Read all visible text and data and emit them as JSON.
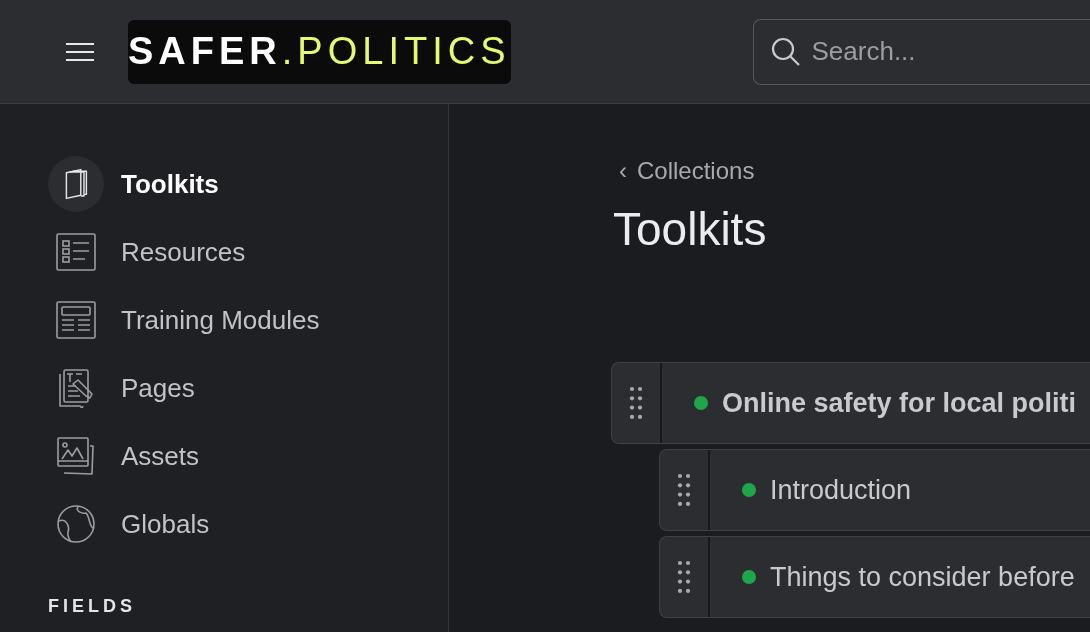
{
  "header": {
    "logo": "**SAFER**.POLITICS",
    "search": {
      "placeholder": "Search..."
    }
  },
  "sidebar": {
    "items": [
      {
        "label": "Toolkits",
        "selected": true
      },
      {
        "label": "Resources",
        "selected": false
      },
      {
        "label": "Training Modules",
        "selected": false
      },
      {
        "label": "Pages",
        "selected": false
      },
      {
        "label": "Assets",
        "selected": false
      },
      {
        "label": "Globals",
        "selected": false
      }
    ],
    "section_heading": "FIELDS"
  },
  "main": {
    "breadcrumb": {
      "caret": "‹",
      "label": "Collections"
    },
    "title": "Toolkits",
    "tree": [
      {
        "title": "Online safety for local politi",
        "color": "#1fa64a",
        "children": [
          {
            "title": "Introduction",
            "color": "#1fa64a"
          },
          {
            "title": "Things to consider before",
            "color": "#1fa64a"
          }
        ]
      }
    ]
  }
}
